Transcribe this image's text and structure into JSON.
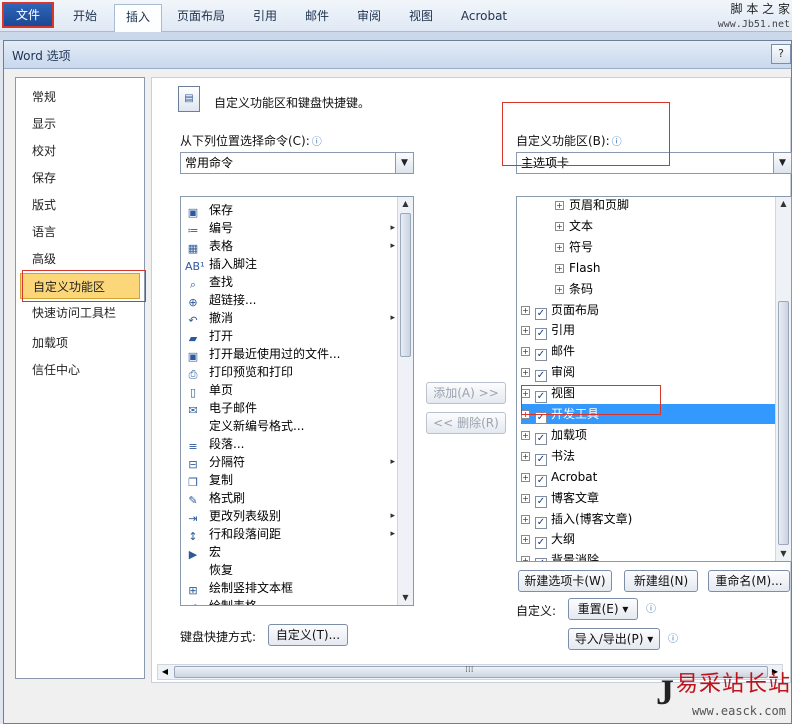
{
  "ribbon": {
    "tabs": [
      "文件",
      "开始",
      "插入",
      "页面布局",
      "引用",
      "邮件",
      "审阅",
      "视图",
      "Acrobat"
    ],
    "watermark_line1": "脚 本 之 家",
    "watermark_line2": "www.Jb51.net"
  },
  "dialog": {
    "title": "Word 选项",
    "help": "?"
  },
  "nav": {
    "items": [
      "常规",
      "显示",
      "校对",
      "保存",
      "版式",
      "语言",
      "高级",
      "自定义功能区",
      "快速访问工具栏",
      "加载项",
      "信任中心"
    ],
    "selected": "自定义功能区"
  },
  "main": {
    "heading": "自定义功能区和键盘快捷键。",
    "left_label": "从下列位置选择命令(C):",
    "left_combo": "常用命令",
    "right_label": "自定义功能区(B):",
    "right_combo": "主选项卡",
    "info_glyph": "ⓘ",
    "commands": [
      {
        "label": "保存",
        "icon": "save-icon",
        "glyph": "▣",
        "sub": ""
      },
      {
        "label": "编号",
        "icon": "numbering-icon",
        "glyph": "≔",
        "sub": "▸"
      },
      {
        "label": "表格",
        "icon": "table-icon",
        "glyph": "▦",
        "sub": "▸"
      },
      {
        "label": "插入脚注",
        "icon": "footnote-icon",
        "glyph": "AB¹",
        "sub": ""
      },
      {
        "label": "查找",
        "icon": "find-icon",
        "glyph": "⌕",
        "sub": ""
      },
      {
        "label": "超链接...",
        "icon": "hyperlink-icon",
        "glyph": "⊕",
        "sub": ""
      },
      {
        "label": "撤消",
        "icon": "undo-icon",
        "glyph": "↶",
        "sub": "▸"
      },
      {
        "label": "打开",
        "icon": "open-folder-icon",
        "glyph": "▰",
        "sub": ""
      },
      {
        "label": "打开最近使用过的文件...",
        "icon": "recent-file-icon",
        "glyph": "▣",
        "sub": ""
      },
      {
        "label": "打印预览和打印",
        "icon": "print-preview-icon",
        "glyph": "⎙",
        "sub": ""
      },
      {
        "label": "单页",
        "icon": "single-page-icon",
        "glyph": "▯",
        "sub": ""
      },
      {
        "label": "电子邮件",
        "icon": "email-icon",
        "glyph": "✉",
        "sub": ""
      },
      {
        "label": "定义新编号格式...",
        "icon": "",
        "glyph": "",
        "sub": ""
      },
      {
        "label": "段落...",
        "icon": "paragraph-icon",
        "glyph": "≡",
        "sub": ""
      },
      {
        "label": "分隔符",
        "icon": "separator-icon",
        "glyph": "⊟",
        "sub": "▸"
      },
      {
        "label": "复制",
        "icon": "copy-icon",
        "glyph": "❐",
        "sub": ""
      },
      {
        "label": "格式刷",
        "icon": "format-painter-icon",
        "glyph": "✎",
        "sub": ""
      },
      {
        "label": "更改列表级别",
        "icon": "list-level-icon",
        "glyph": "⇥",
        "sub": "▸"
      },
      {
        "label": "行和段落间距",
        "icon": "line-spacing-icon",
        "glyph": "↕",
        "sub": "▸"
      },
      {
        "label": "宏",
        "icon": "macro-icon",
        "glyph": "▶",
        "sub": ""
      },
      {
        "label": "恢复",
        "icon": "",
        "glyph": "",
        "sub": ""
      },
      {
        "label": "绘制竖排文本框",
        "icon": "vertical-textbox-icon",
        "glyph": "⊞",
        "sub": ""
      },
      {
        "label": "绘制表格",
        "icon": "draw-table-icon",
        "glyph": "✐",
        "sub": ""
      }
    ],
    "add_button": "添加(A) >>",
    "remove_button": "<< 删除(R)",
    "tree": [
      {
        "label": "页眉和页脚",
        "level": 2,
        "check": false
      },
      {
        "label": "文本",
        "level": 2,
        "check": false
      },
      {
        "label": "符号",
        "level": 2,
        "check": false
      },
      {
        "label": "Flash",
        "level": 2,
        "check": false
      },
      {
        "label": "条码",
        "level": 2,
        "check": false
      },
      {
        "label": "页面布局",
        "level": 1,
        "check": true
      },
      {
        "label": "引用",
        "level": 1,
        "check": true
      },
      {
        "label": "邮件",
        "level": 1,
        "check": true
      },
      {
        "label": "审阅",
        "level": 1,
        "check": true
      },
      {
        "label": "视图",
        "level": 1,
        "check": true
      },
      {
        "label": "开发工具",
        "level": 1,
        "check": true,
        "selected": true
      },
      {
        "label": "加载项",
        "level": 1,
        "check": true
      },
      {
        "label": "书法",
        "level": 1,
        "check": true
      },
      {
        "label": "Acrobat",
        "level": 1,
        "check": true
      },
      {
        "label": "博客文章",
        "level": 1,
        "check": true
      },
      {
        "label": "插入(博客文章)",
        "level": 1,
        "check": true
      },
      {
        "label": "大纲",
        "level": 1,
        "check": true
      },
      {
        "label": "背景消除",
        "level": 1,
        "check": true
      }
    ],
    "expander_glyph": "+",
    "check_glyph": "✓",
    "new_tab_button": "新建选项卡(W)",
    "new_group_button": "新建组(N)",
    "rename_button": "重命名(M)...",
    "customize_label": "自定义:",
    "reset_button": "重置(E) ▾",
    "import_export_button": "导入/导出(P) ▾",
    "keyboard_label": "键盘快捷方式:",
    "keyboard_button": "自定义(T)...",
    "hscroll_grip": "⁞⁞⁞"
  },
  "watermark_bottom": {
    "logo": "J",
    "text": "易采站长站",
    "url": "www.easck.com"
  },
  "colors": {
    "accent_red": "#d8352b",
    "selection_blue": "#3399ff",
    "nav_selected": "#fcd77a"
  }
}
